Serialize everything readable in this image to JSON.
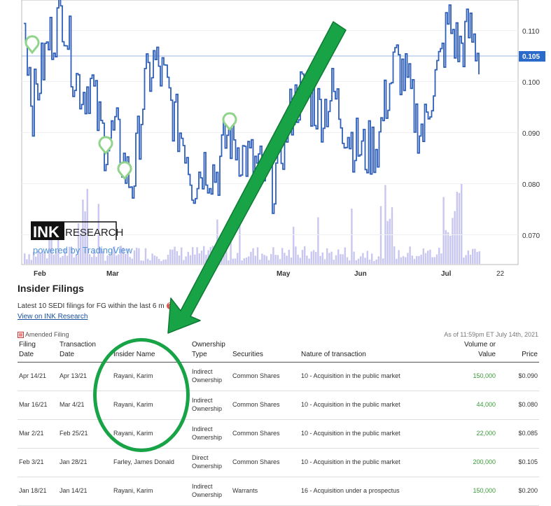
{
  "chart": {
    "y_axis_labels": [
      "0.110",
      "0.100",
      "0.090",
      "0.080",
      "0.070"
    ],
    "current_price": "0.105",
    "x_axis_labels": [
      "Feb",
      "Mar",
      "May",
      "Jun",
      "Jul",
      "22"
    ],
    "logo_ink": "INK",
    "logo_research": "RESEARCH",
    "powered_by": "powered by TradingView",
    "colors": {
      "price_line": "#2f5fb8",
      "volume": "#c9c6f0",
      "marker": "#8fd48a",
      "current_price_bg": "#2a6acb"
    }
  },
  "filings": {
    "title": "Insider Filings",
    "subtitle": "Latest 10 SEDI filings for FG within the last 6 m",
    "view_link": "View on INK Research",
    "amended_label": "Amended Filing",
    "as_of": "As of 11:59pm ET July 14th, 2021",
    "headers": {
      "filing_date": [
        "Filing",
        "Date"
      ],
      "transaction_date": [
        "Transaction",
        "Date"
      ],
      "insider_name": "Insider Name",
      "ownership_type": [
        "Ownership",
        "Type"
      ],
      "securities": "Securities",
      "nature": "Nature of transaction",
      "volume": [
        "Volume or",
        "Value"
      ],
      "price": "Price"
    },
    "rows": [
      {
        "filing_date": "Apr 14/21",
        "transaction_date": "Apr 13/21",
        "insider": "Rayani, Karim",
        "ownership": [
          "Indirect",
          "Ownership"
        ],
        "securities": "Common Shares",
        "nature": "10 - Acquisition in the public market",
        "volume": "150,000",
        "price": "$0.090"
      },
      {
        "filing_date": "Mar 16/21",
        "transaction_date": "Mar 4/21",
        "insider": "Rayani, Karim",
        "ownership": [
          "Indirect",
          "Ownership"
        ],
        "securities": "Common Shares",
        "nature": "10 - Acquisition in the public market",
        "volume": "44,000",
        "price": "$0.080"
      },
      {
        "filing_date": "Mar 2/21",
        "transaction_date": "Feb 25/21",
        "insider": "Rayani, Karim",
        "ownership": [
          "Indirect",
          "Ownership"
        ],
        "securities": "Common Shares",
        "nature": "10 - Acquisition in the public market",
        "volume": "22,000",
        "price": "$0.085"
      },
      {
        "filing_date": "Feb 3/21",
        "transaction_date": "Jan 28/21",
        "insider": "Farley, James Donald",
        "ownership": [
          "Direct",
          "Ownership"
        ],
        "securities": "Common Shares",
        "nature": "10 - Acquisition in the public market",
        "volume": "200,000",
        "price": "$0.105"
      },
      {
        "filing_date": "Jan 18/21",
        "transaction_date": "Jan 14/21",
        "insider": "Rayani, Karim",
        "ownership": [
          "Indirect",
          "Ownership"
        ],
        "securities": "Warrants",
        "nature": "16 - Acquisition under a prospectus",
        "volume": "150,000",
        "price": "$0.200"
      }
    ]
  }
}
